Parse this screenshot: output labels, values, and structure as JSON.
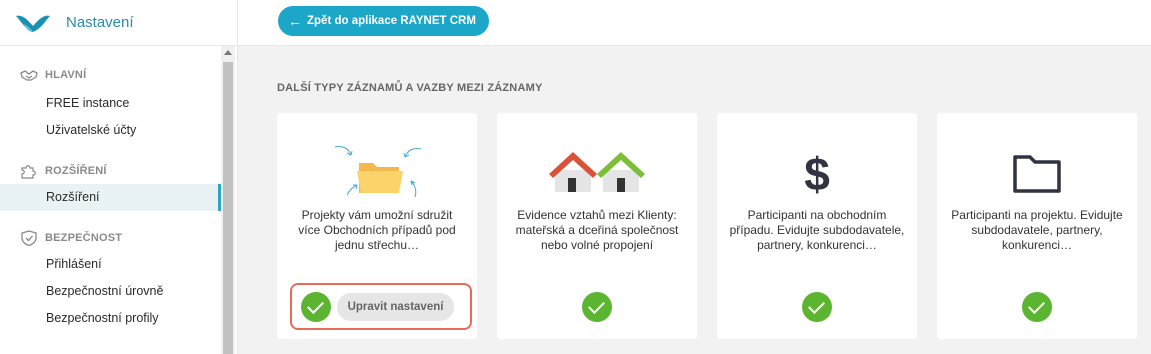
{
  "sidebar": {
    "title": "Nastavení",
    "sections": [
      {
        "label": "HLAVNÍ",
        "icon": "handshake-icon",
        "items": [
          {
            "label": "FREE instance"
          },
          {
            "label": "Uživatelské účty"
          }
        ]
      },
      {
        "label": "ROZŠÍŘENÍ",
        "icon": "puzzle-icon",
        "items": [
          {
            "label": "Rozšíření",
            "active": true
          }
        ]
      },
      {
        "label": "BEZPEČNOST",
        "icon": "shield-icon",
        "items": [
          {
            "label": "Přihlášení"
          },
          {
            "label": "Bezpečnostní úrovně"
          },
          {
            "label": "Bezpečnostní profily"
          }
        ]
      }
    ]
  },
  "topbar": {
    "back_label": "Zpět do aplikace RAYNET CRM"
  },
  "main": {
    "section_title": "DALŠÍ TYPY ZÁZNAMŮ A VAZBY MEZI ZÁZNAMY",
    "cards": [
      {
        "icon": "folder-arrows-icon",
        "description": "Projekty vám umožní sdružit více Obchodních případů pod jednu střechu…",
        "enabled": true,
        "button_label": "Upravit nastavení"
      },
      {
        "icon": "houses-icon",
        "description": "Evidence vztahů mezi Klienty: mateřská a dceřiná společnost nebo volné propojení",
        "enabled": true
      },
      {
        "icon": "dollar-icon",
        "description": "Participanti na obchodním případu. Evidujte subdodavatele, partnery, konkurenci…",
        "enabled": true
      },
      {
        "icon": "folder-outline-icon",
        "description": "Participanti na projektu. Evidujte subdodavatele, partnery, konkurenci…",
        "enabled": true
      }
    ]
  },
  "colors": {
    "accent": "#1ca7c9",
    "success": "#5cb531",
    "highlight": "#e86b59"
  }
}
